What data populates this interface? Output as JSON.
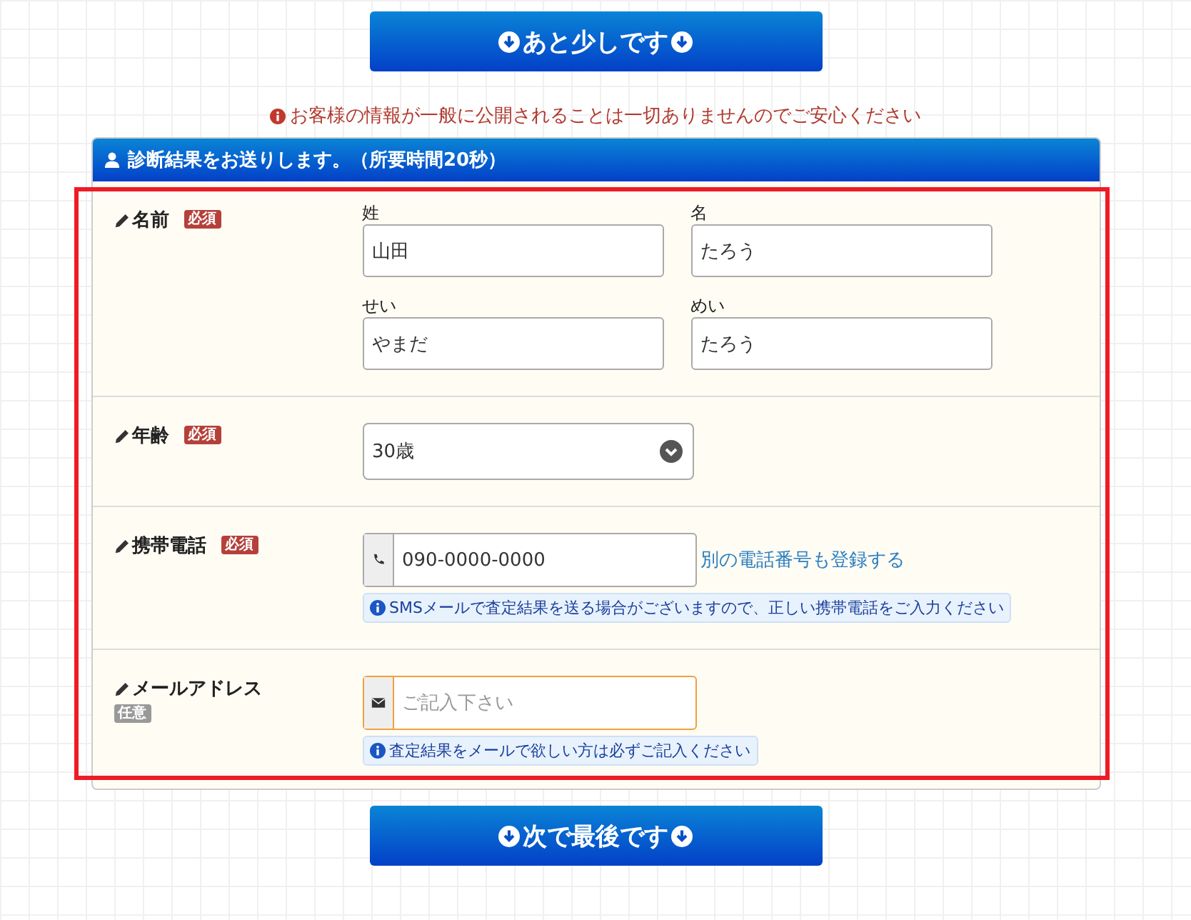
{
  "top_button": {
    "label": "あと少しです"
  },
  "notice": "お客様の情報が一般に公開されることは一切ありませんのでご安心ください",
  "panel": {
    "title": "診断結果をお送りします。（所要時間20秒）",
    "highlighted": true
  },
  "rows": [
    {
      "kind": "name",
      "label": "名前",
      "badge": "必須",
      "required": true,
      "fields": [
        {
          "label": "姓",
          "value": "山田"
        },
        {
          "label": "名",
          "value": "たろう"
        },
        {
          "label": "せい",
          "value": "やまだ"
        },
        {
          "label": "めい",
          "value": "たろう"
        }
      ]
    },
    {
      "kind": "select",
      "label": "年齢",
      "badge": "必須",
      "required": true,
      "value": "30歳"
    },
    {
      "kind": "phone",
      "label": "携帯電話",
      "badge": "必須",
      "required": true,
      "value": "090-0000-0000",
      "link": "別の電話番号も登録する",
      "hint": "SMSメールで査定結果を送る場合がございますので、正しい携帯電話をご入力ください"
    },
    {
      "kind": "email",
      "label": "メールアドレス",
      "badge": "任意",
      "required": false,
      "placeholder": "ご記入下さい",
      "focused": true,
      "hint": "査定結果をメールで欲しい方は必ずご記入ください"
    }
  ],
  "bottom_button": {
    "label": "次で最後です"
  }
}
